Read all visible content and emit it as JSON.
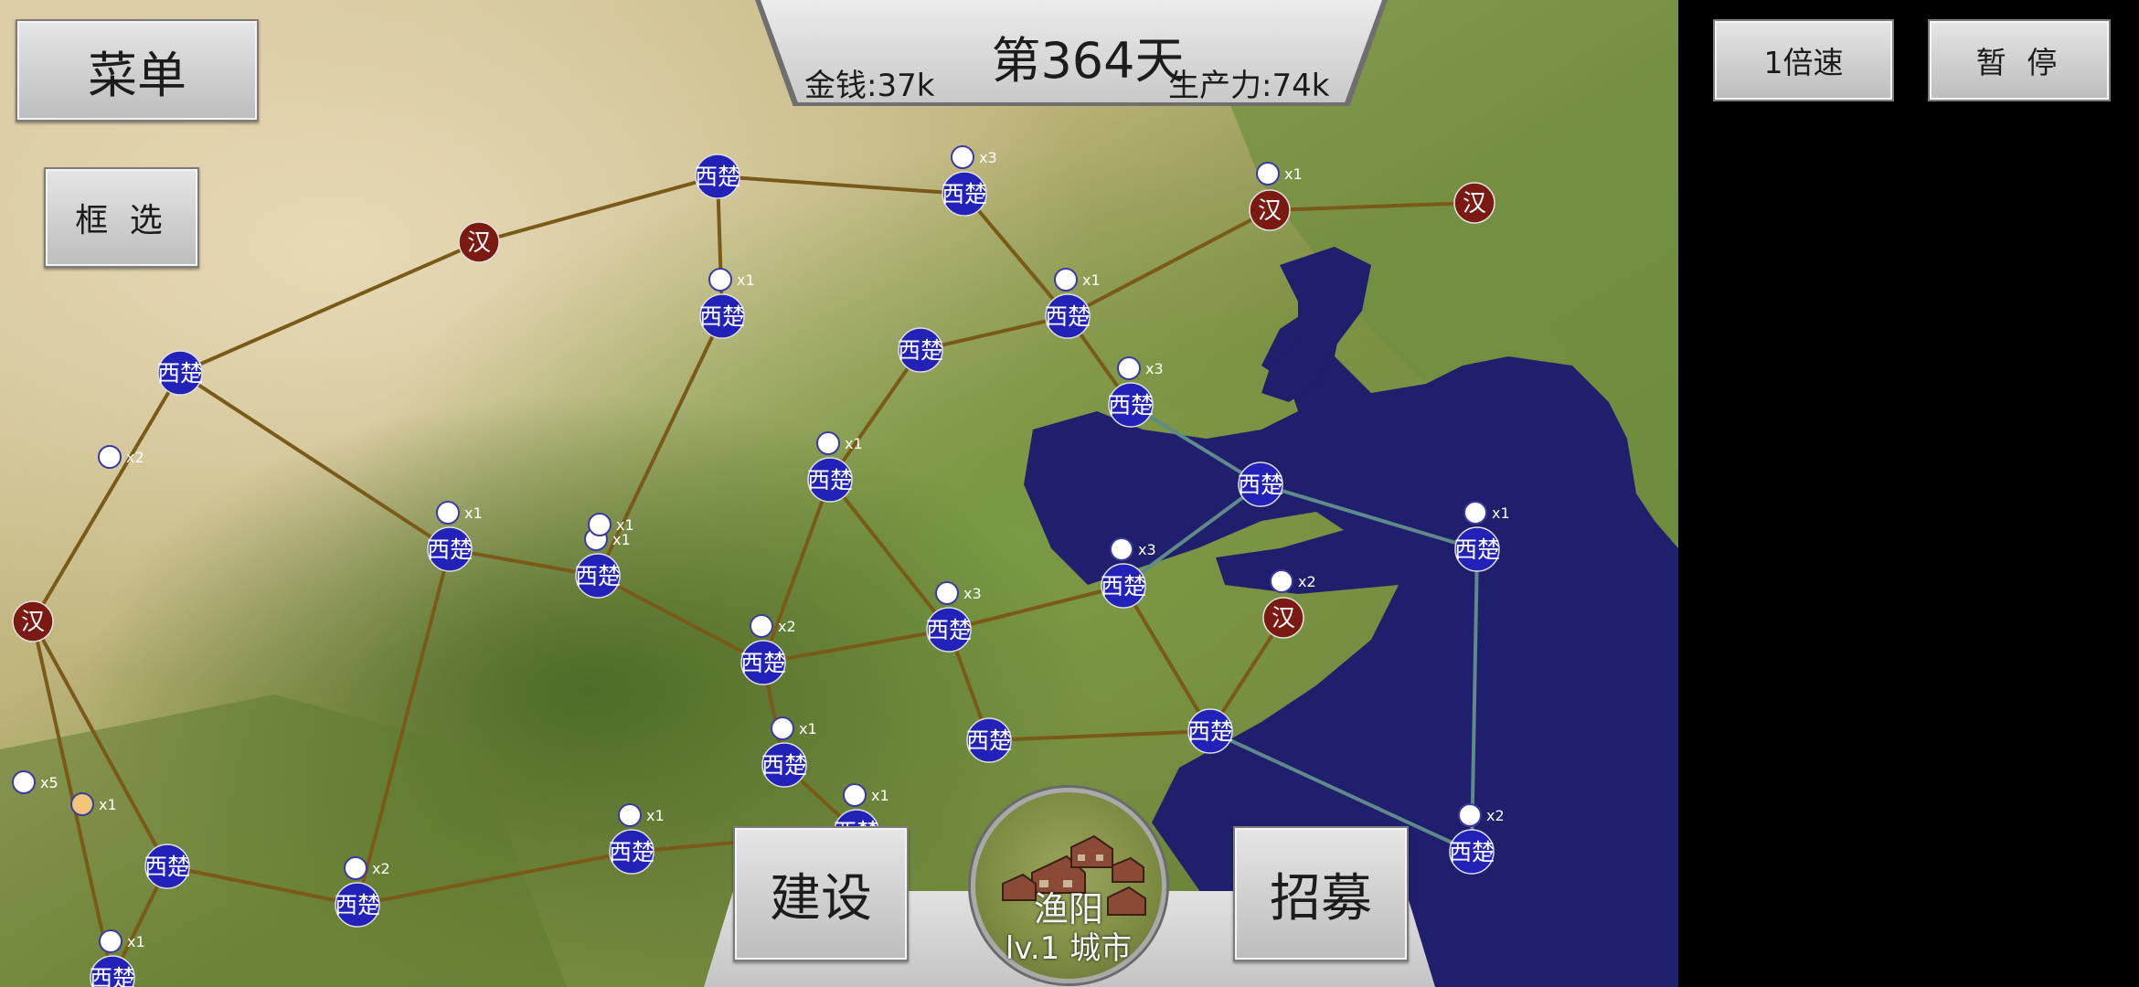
{
  "hud": {
    "day": "第364天",
    "money": "金钱:37k",
    "productivity": "生产力:74k"
  },
  "buttons": {
    "menu": "菜单",
    "box_select": "框 选",
    "speed": "1倍速",
    "pause": "暂 停",
    "build": "建设",
    "recruit": "招募"
  },
  "selected_city": {
    "name": "渔阳",
    "level": "lv.1 城市"
  },
  "factions": {
    "xichu": {
      "label": "西楚",
      "color": "#2222b8"
    },
    "han": {
      "label": "汉",
      "color": "#7a1a12"
    }
  },
  "map": {
    "nodes": [
      {
        "id": "n1",
        "faction": "xichu",
        "army": ""
      },
      {
        "id": "n2",
        "faction": "xichu",
        "army": "x3"
      },
      {
        "id": "n3",
        "faction": "han",
        "army": "x1"
      },
      {
        "id": "n4",
        "faction": "han",
        "army": ""
      },
      {
        "id": "n5",
        "faction": "han",
        "army": ""
      },
      {
        "id": "n6",
        "faction": "xichu",
        "army": "x1"
      },
      {
        "id": "n7",
        "faction": "xichu",
        "army": "x1"
      },
      {
        "id": "n8",
        "faction": "xichu",
        "army": ""
      },
      {
        "id": "n9",
        "faction": "xichu",
        "army": "x3"
      },
      {
        "id": "n10",
        "faction": "xichu",
        "army": ""
      },
      {
        "id": "n11",
        "faction": "xichu",
        "army": "x1"
      },
      {
        "id": "n12",
        "faction": "xichu",
        "army": ""
      },
      {
        "id": "n13",
        "faction": "xichu",
        "army": "x1"
      },
      {
        "id": "n14",
        "faction": "xichu",
        "army": "x1"
      },
      {
        "id": "n15",
        "faction": "xichu",
        "army": "x3"
      },
      {
        "id": "n16",
        "faction": "han",
        "army": ""
      },
      {
        "id": "n17",
        "faction": "xichu",
        "army": "x1"
      },
      {
        "id": "n18",
        "faction": "xichu",
        "army": "x3"
      },
      {
        "id": "n19",
        "faction": "han",
        "army": "x2"
      },
      {
        "id": "n20",
        "faction": "xichu",
        "army": "x2"
      },
      {
        "id": "n21",
        "faction": "xichu",
        "army": ""
      },
      {
        "id": "n22",
        "faction": "xichu",
        "army": ""
      },
      {
        "id": "n23",
        "faction": "xichu",
        "army": "x1"
      },
      {
        "id": "n24",
        "faction": "xichu",
        "army": "x1"
      },
      {
        "id": "n25",
        "faction": "xichu",
        "army": "x2"
      },
      {
        "id": "n26",
        "faction": "xichu",
        "army": ""
      },
      {
        "id": "n27",
        "faction": "xichu",
        "army": "x1"
      },
      {
        "id": "n28",
        "faction": "xichu",
        "army": "x2"
      },
      {
        "id": "n29",
        "faction": "xichu",
        "army": "x1"
      }
    ],
    "extra_markers": [
      {
        "id": "m1",
        "army": "x2"
      },
      {
        "id": "m2",
        "army": "x5"
      },
      {
        "id": "m3",
        "army": "x1"
      },
      {
        "id": "m4",
        "army": "x1"
      }
    ]
  }
}
